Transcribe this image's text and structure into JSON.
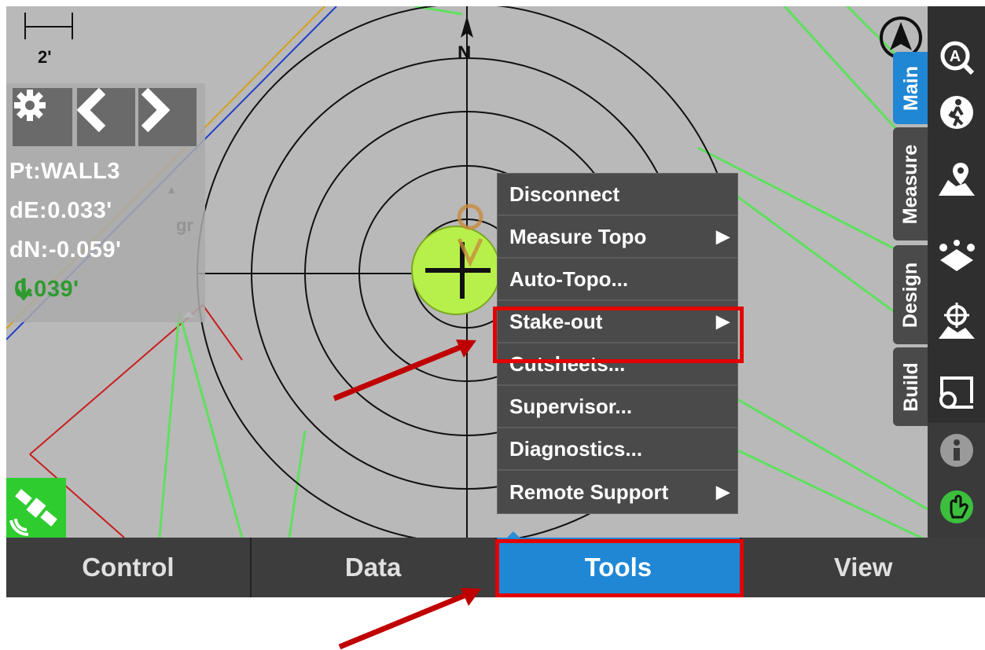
{
  "map": {
    "scale_label": "2'",
    "north_label": "N",
    "ground_text": "gr"
  },
  "point_panel": {
    "point": "Pt:WALL3",
    "de": "dE:0.033'",
    "dn": "dN:-0.059'",
    "dz": "0.039'"
  },
  "menu": {
    "items": [
      {
        "label": "Disconnect",
        "submenu": false
      },
      {
        "label": "Measure Topo",
        "submenu": true
      },
      {
        "label": "Auto-Topo...",
        "submenu": false
      },
      {
        "label": "Stake-out",
        "submenu": true
      },
      {
        "label": "Cutsheets...",
        "submenu": false
      },
      {
        "label": "Supervisor...",
        "submenu": false
      },
      {
        "label": "Diagnostics...",
        "submenu": false
      },
      {
        "label": "Remote Support",
        "submenu": true
      }
    ],
    "submenu_arrow": "▶"
  },
  "tabs": [
    {
      "label": "Control",
      "active": false
    },
    {
      "label": "Data",
      "active": false
    },
    {
      "label": "Tools",
      "active": true
    },
    {
      "label": "View",
      "active": false
    }
  ],
  "side_tabs": [
    {
      "label": "Main",
      "active": true
    },
    {
      "label": "Measure",
      "active": false
    },
    {
      "label": "Design",
      "active": false
    },
    {
      "label": "Build",
      "active": false
    }
  ],
  "right_icons": [
    "auto-zoom-icon",
    "walk-icon",
    "map-pin-icon",
    "points-icon",
    "target-map-icon",
    "roll-plan-icon",
    "info-icon",
    "hand-icon"
  ],
  "colors": {
    "accent": "#1f87d4",
    "highlight": "#e30000",
    "annotation_arrow": "#c00000",
    "level_good": "#2e9b2e",
    "satellite": "#2fcc2f"
  }
}
